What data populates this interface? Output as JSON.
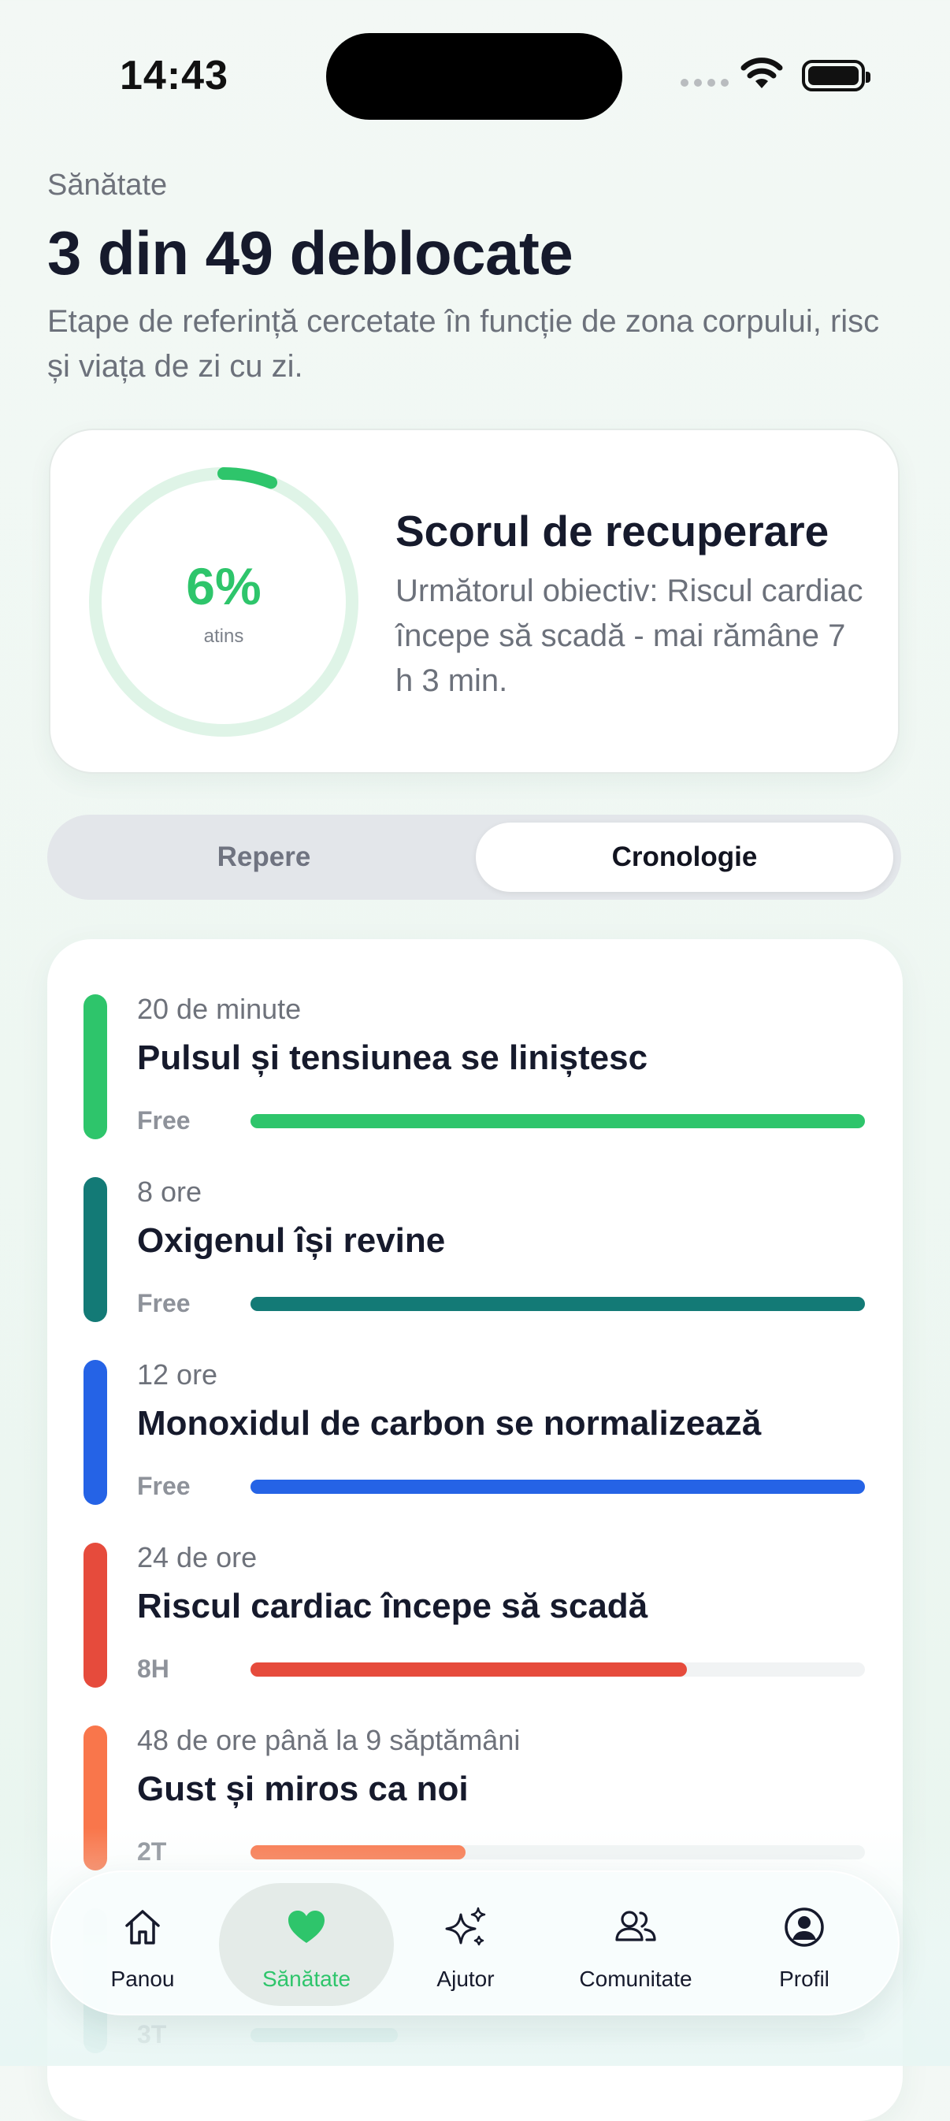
{
  "status_bar": {
    "time": "14:43"
  },
  "header": {
    "overline": "Sănătate",
    "title": "3 din 49 deblocate",
    "subtitle": "Etape de referință cercetate în funcție de zona corpului, risc și viața de zi cu zi."
  },
  "score_card": {
    "percent_label": "6%",
    "progress": 0.06,
    "caption": "atins",
    "title": "Scorul de recuperare",
    "description": "Următorul obiectiv: Riscul cardiac începe să scadă - mai rămâne 7 h 3 min.",
    "accent_color": "#2ec56b"
  },
  "segmented_control": {
    "options": [
      "Repere",
      "Cronologie"
    ],
    "selected": "Cronologie"
  },
  "timeline": [
    {
      "when": "20 de minute",
      "title": "Pulsul și tensiunea se liniștesc",
      "tag": "Free",
      "progress": 1.0,
      "color": "#2ec56b"
    },
    {
      "when": "8 ore",
      "title": "Oxigenul își revine",
      "tag": "Free",
      "progress": 1.0,
      "color": "#137a76"
    },
    {
      "when": "12 ore",
      "title": "Monoxidul de carbon se normalizează",
      "tag": "Free",
      "progress": 1.0,
      "color": "#2563e6"
    },
    {
      "when": "24 de ore",
      "title": "Riscul cardiac începe să scadă",
      "tag": "8H",
      "progress": 0.71,
      "color": "#e64b3c"
    },
    {
      "when": "48 de ore până la 9 săptămâni",
      "title": "Gust și miros ca noi",
      "tag": "2T",
      "progress": 0.35,
      "color": "#f9764b"
    },
    {
      "when": "",
      "title": "",
      "tag": "3T",
      "progress": 0.24,
      "color": "#9fd0cd"
    }
  ],
  "tab_bar": {
    "items": [
      {
        "label": "Panou",
        "icon": "home-icon"
      },
      {
        "label": "Sănătate",
        "icon": "heart-icon"
      },
      {
        "label": "Ajutor",
        "icon": "sparkles-icon"
      },
      {
        "label": "Comunitate",
        "icon": "people-icon"
      },
      {
        "label": "Profil",
        "icon": "profile-icon"
      }
    ],
    "active": "Sănătate"
  }
}
